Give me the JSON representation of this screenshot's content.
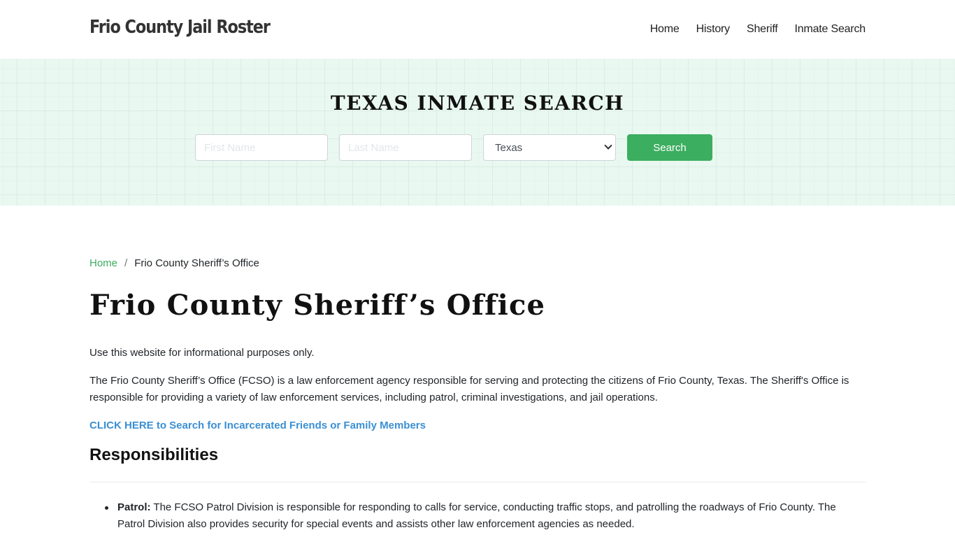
{
  "header": {
    "brand": "Frio County Jail Roster",
    "nav": [
      {
        "label": "Home"
      },
      {
        "label": "History"
      },
      {
        "label": "Sheriff"
      },
      {
        "label": "Inmate Search"
      }
    ]
  },
  "hero": {
    "title": "TEXAS INMATE SEARCH",
    "first_name_placeholder": "First Name",
    "last_name_placeholder": "Last Name",
    "state_selected": "Texas",
    "search_label": "Search"
  },
  "breadcrumb": {
    "home": "Home",
    "separator": "/",
    "current": "Frio County Sheriff’s Office"
  },
  "main": {
    "title": "Frio County Sheriff’s Office",
    "disclaimer": "Use this website for informational purposes only.",
    "intro": "The Frio County Sheriff’s Office (FCSO) is a law enforcement agency responsible for serving and protecting the citizens of Frio County, Texas. The Sheriff's Office is responsible for providing a variety of law enforcement services, including patrol, criminal investigations, and jail operations.",
    "cta_link": "CLICK HERE to Search for Incarcerated Friends or Family Members",
    "section_heading": "Responsibilities",
    "responsibilities": [
      {
        "term": "Patrol:",
        "text": " The FCSO Patrol Division is responsible for responding to calls for service, conducting traffic stops, and patrolling the roadways of Frio County. The Patrol Division also provides security for special events and assists other law enforcement agencies as needed."
      }
    ]
  },
  "colors": {
    "accent_green": "#3cae5f",
    "link_blue": "#3a8fd4",
    "hero_bg": "#e9f8f1"
  }
}
